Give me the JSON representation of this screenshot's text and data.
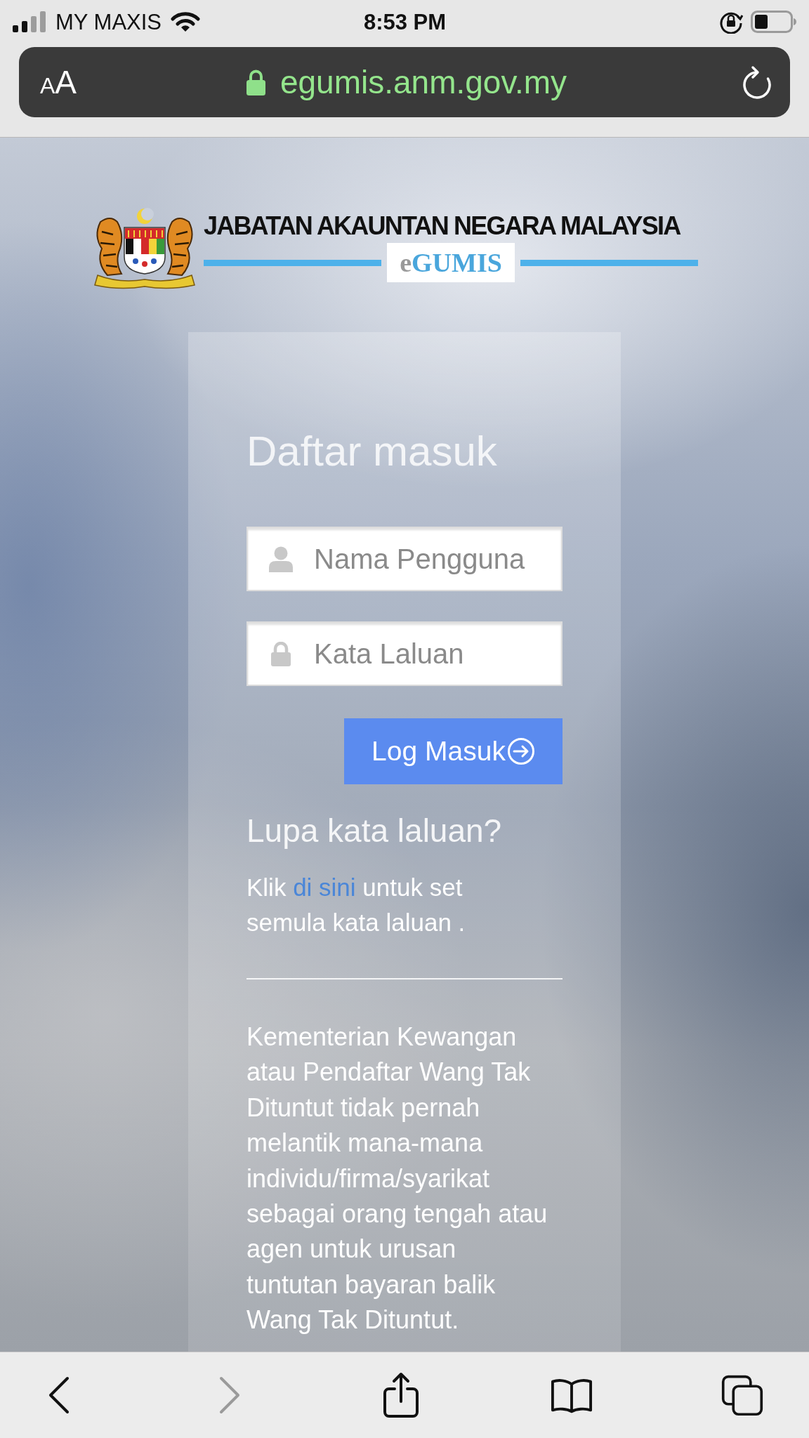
{
  "status_bar": {
    "carrier": "MY MAXIS",
    "time": "8:53 PM"
  },
  "address_bar": {
    "text_size": "AA",
    "url": "egumis.anm.gov.my"
  },
  "header": {
    "title": "JABATAN AKAUNTAN NEGARA MALAYSIA",
    "logo": "eGUMIS"
  },
  "login": {
    "title": "Daftar masuk",
    "fields": [
      {
        "kind": "username",
        "placeholder": "Nama Pengguna"
      },
      {
        "kind": "password",
        "placeholder": "Kata Laluan"
      }
    ],
    "submit": "Log Masuk"
  },
  "forgot_password": {
    "title": "Lupa kata laluan?",
    "text_before": "Klik",
    "link": "di sini",
    "text_after": "untuk set semula kata laluan ."
  },
  "notice": "Kementerian Kewangan atau Pendaftar Wang Tak Dituntut tidak pernah melantik mana-mana individu/firma/syarikat sebagai orang tengah atau agen untuk urusan tuntutan bayaran balik Wang Tak Dituntut.",
  "toolbar": [
    {
      "kind": "back",
      "disabled": false
    },
    {
      "kind": "forward",
      "disabled": true
    },
    {
      "kind": "share",
      "disabled": false
    },
    {
      "kind": "bookmarks",
      "disabled": false
    },
    {
      "kind": "tabs",
      "disabled": false
    }
  ]
}
